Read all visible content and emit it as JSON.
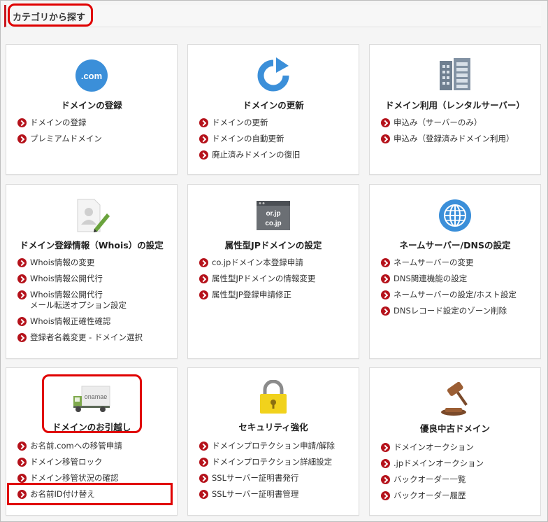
{
  "header": {
    "title": "カテゴリから探す"
  },
  "cards": [
    {
      "title": "ドメインの登録",
      "icon": "dotcom-icon",
      "icon_text": ".com",
      "links": [
        "ドメインの登録",
        "プレミアムドメイン"
      ]
    },
    {
      "title": "ドメインの更新",
      "icon": "refresh-icon",
      "links": [
        "ドメインの更新",
        "ドメインの自動更新",
        "廃止済みドメインの復旧"
      ]
    },
    {
      "title": "ドメイン利用（レンタルサーバー）",
      "icon": "server-icon",
      "links": [
        "申込み（サーバーのみ）",
        "申込み（登録済みドメイン利用）"
      ]
    },
    {
      "title": "ドメイン登録情報（Whois）の設定",
      "icon": "user-edit-icon",
      "links": [
        "Whois情報の変更",
        "Whois情報公開代行",
        "Whois情報公開代行\nメール転送オプション設定",
        "Whois情報正確性確認",
        "登録者名義変更 - ドメイン選択"
      ]
    },
    {
      "title": "属性型JPドメインの設定",
      "icon": "jp-domain-icon",
      "icon_text_1": "or.jp",
      "icon_text_2": "co.jp",
      "links": [
        "co.jpドメイン本登録申請",
        "属性型JPドメインの情報変更",
        "属性型JP登録申請修正"
      ]
    },
    {
      "title": "ネームサーバー/DNSの設定",
      "icon": "globe-icon",
      "links": [
        "ネームサーバーの変更",
        "DNS関連機能の設定",
        "ネームサーバーの設定/ホスト設定",
        "DNSレコード設定のゾーン削除"
      ]
    },
    {
      "title": "ドメインのお引越し",
      "icon": "truck-icon",
      "icon_text": "onamae",
      "links": [
        "お名前.comへの移管申請",
        "ドメイン移管ロック",
        "ドメイン移管状況の確認",
        "お名前ID付け替え"
      ]
    },
    {
      "title": "セキュリティ強化",
      "icon": "lock-icon",
      "links": [
        "ドメインプロテクション申請/解除",
        "ドメインプロテクション詳細設定",
        "SSLサーバー証明書発行",
        "SSLサーバー証明書管理"
      ]
    },
    {
      "title": "優良中古ドメイン",
      "icon": "gavel-icon",
      "links": [
        "ドメインオークション",
        ".jpドメインオークション",
        "バックオーダー一覧",
        "バックオーダー履歴"
      ]
    }
  ],
  "colors": {
    "accent": "#c8161d",
    "highlight": "#e00000",
    "icon_blue": "#3b8fd9"
  }
}
